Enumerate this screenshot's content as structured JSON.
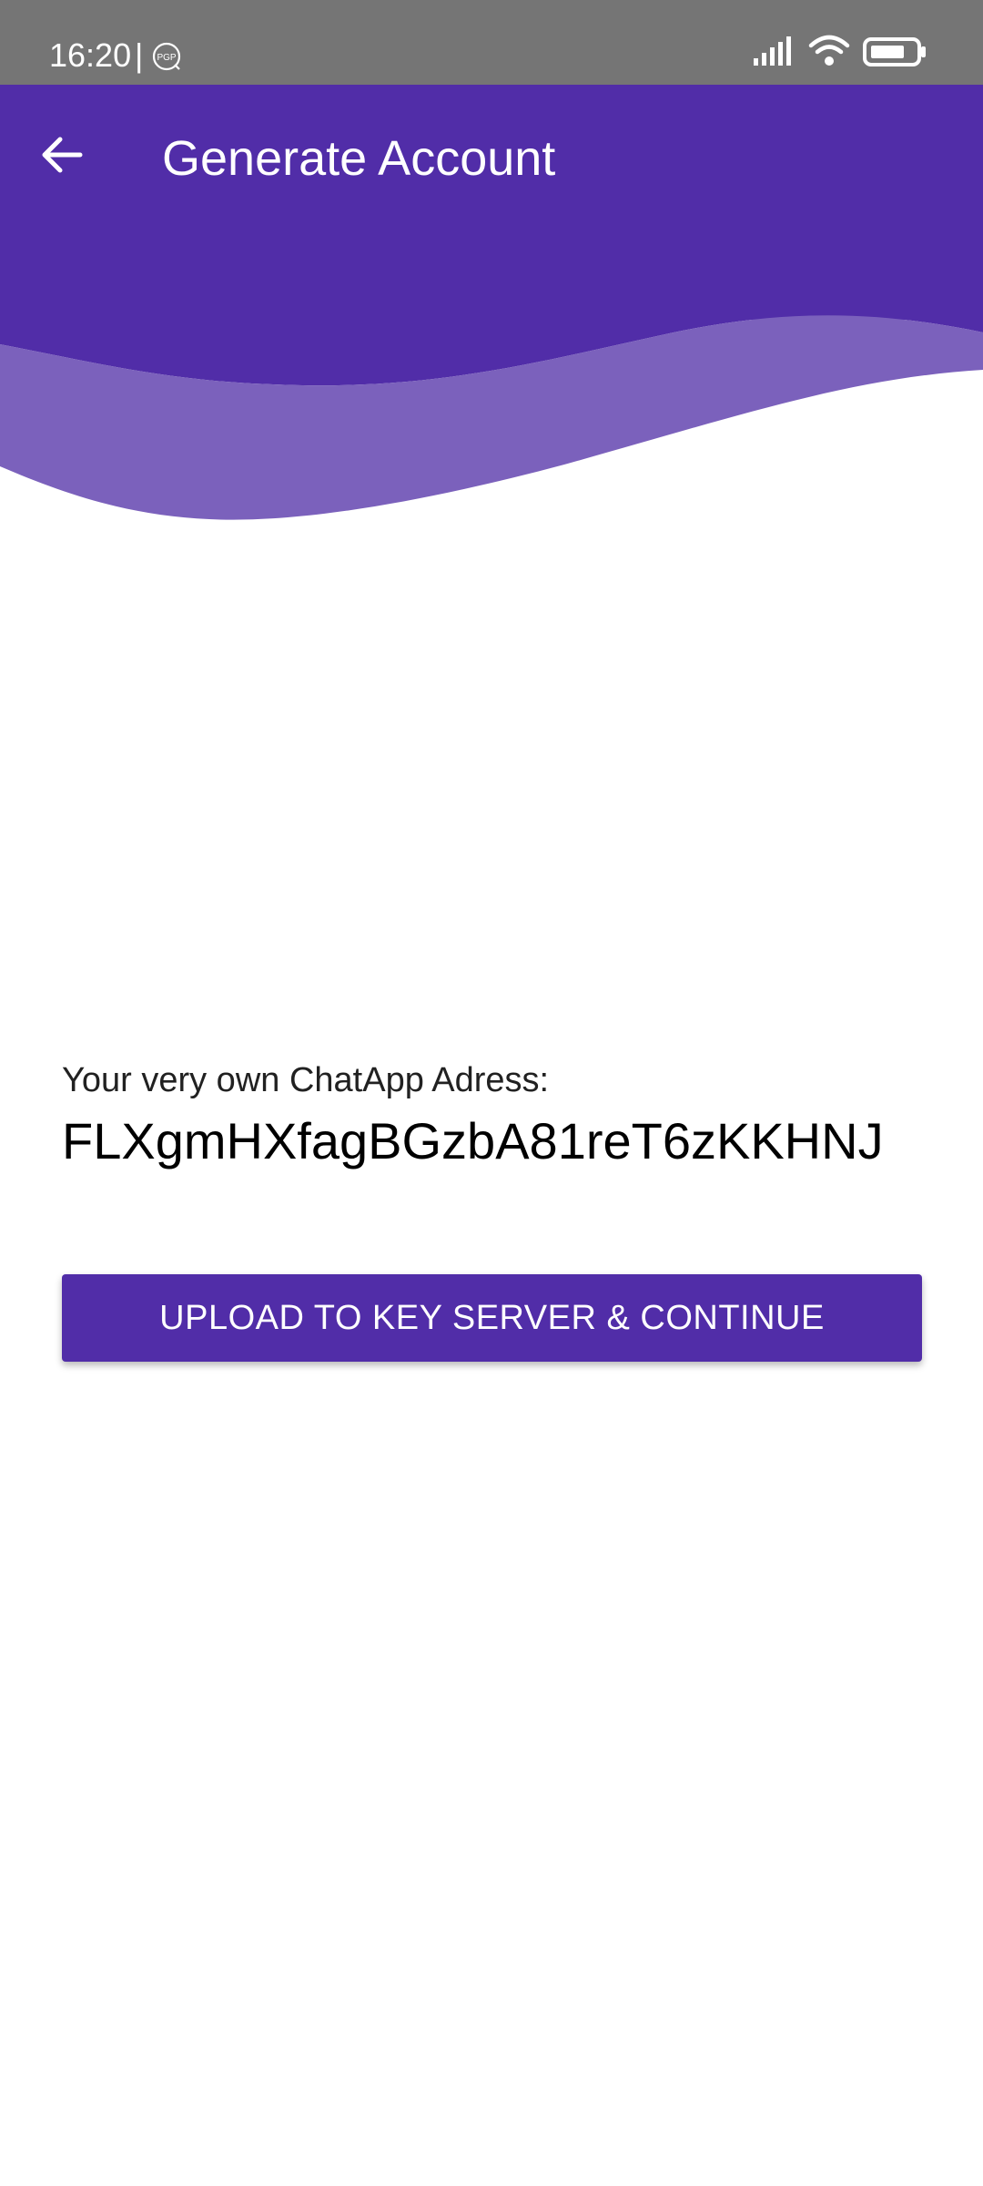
{
  "status_bar": {
    "time": "16:20",
    "separator": "|",
    "notification_icon": "pgp-icon",
    "icons": [
      "signal-icon",
      "wifi-icon",
      "battery-icon"
    ]
  },
  "app_bar": {
    "title": "Generate Account",
    "back_icon": "arrow-back-icon"
  },
  "content": {
    "address_label": "Your very own ChatApp Adress:",
    "address_value": "FLXgmHXfagBGzbA81reT6zKKHNJ"
  },
  "actions": {
    "upload_button_label": "UPLOAD TO KEY SERVER & CONTINUE"
  },
  "colors": {
    "primary": "#512DA8",
    "wave_light": "#7B61BC",
    "status_bar": "#757575"
  }
}
